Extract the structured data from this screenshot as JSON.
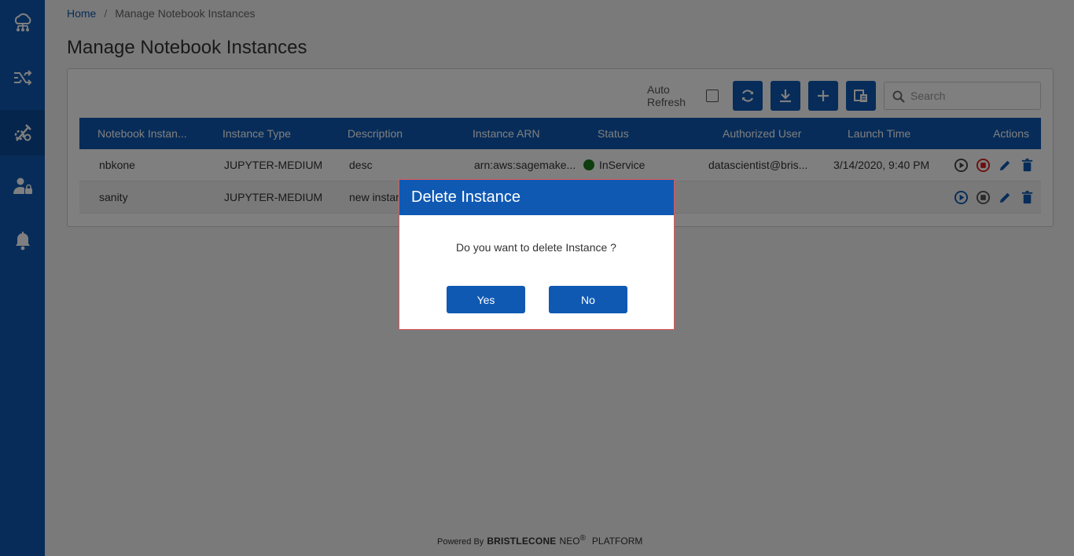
{
  "sidebar": {
    "items": [
      {
        "icon": "cloud-network-icon"
      },
      {
        "icon": "shuffle-icon"
      },
      {
        "icon": "tools-icon",
        "active": true
      },
      {
        "icon": "user-lock-icon"
      },
      {
        "icon": "bell-icon"
      }
    ]
  },
  "breadcrumb": {
    "home": "Home",
    "separator": "/",
    "current": "Manage Notebook Instances"
  },
  "page_title": "Manage Notebook Instances",
  "toolbar": {
    "auto_refresh_line1": "Auto",
    "auto_refresh_line2": "Refresh",
    "auto_refresh_checked": false,
    "search_placeholder": "Search"
  },
  "table": {
    "headers": [
      "Notebook Instan...",
      "Instance Type",
      "Description",
      "Instance ARN",
      "Status",
      "Authorized User",
      "Launch Time",
      "Actions"
    ],
    "rows": [
      {
        "name": "nbkone",
        "type": "JUPYTER-MEDIUM",
        "description": "desc",
        "arn": "arn:aws:sagemake...",
        "status": "InService",
        "user": "datascientist@bris...",
        "launch": "3/14/2020, 9:40 PM"
      },
      {
        "name": "sanity",
        "type": "JUPYTER-MEDIUM",
        "description": "new instan",
        "arn": "",
        "status": "",
        "user": "",
        "launch": ""
      }
    ]
  },
  "footer": {
    "powered_by": "Powered By",
    "brand": "BRISTLECONE",
    "neo": "NEO",
    "reg": "®",
    "platform": "PLATFORM"
  },
  "modal": {
    "title": "Delete Instance",
    "message": "Do you want to delete Instance ?",
    "yes": "Yes",
    "no": "No"
  },
  "colors": {
    "primary": "#0f59b3",
    "status_ok": "#1d7a1d",
    "stop_red": "#d61f1f",
    "modal_border": "#e2565a"
  }
}
